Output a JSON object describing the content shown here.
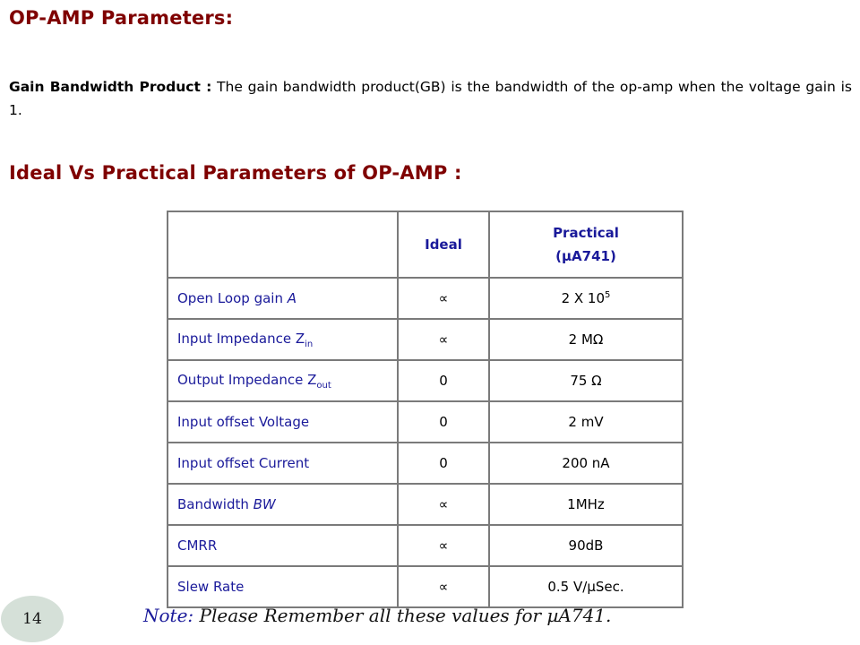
{
  "title": "OP-AMP Parameters:",
  "gbp": {
    "term": "Gain Bandwidth Product :",
    "definition": "The gain bandwidth product(GB) is the bandwidth of the op-amp when the voltage gain is 1."
  },
  "subtitle": "Ideal Vs Practical Parameters of OP-AMP :",
  "table": {
    "headers": [
      "",
      "Ideal",
      "Practical (µA741)"
    ],
    "rows": [
      {
        "name": "Open Loop gain ",
        "name_var": "A",
        "name_sub": "",
        "ideal": "∝",
        "practical": "2 X 10",
        "practical_sup": "5"
      },
      {
        "name": "Input Impedance Z",
        "name_var": "",
        "name_sub": "in",
        "ideal": "∝",
        "practical": "2 MΩ",
        "practical_sup": ""
      },
      {
        "name": "Output Impedance Z",
        "name_var": "",
        "name_sub": "out",
        "ideal": "0",
        "practical": "75 Ω",
        "practical_sup": ""
      },
      {
        "name": "Input offset Voltage",
        "name_var": "",
        "name_sub": "",
        "ideal": "0",
        "practical": "2 mV",
        "practical_sup": ""
      },
      {
        "name": "Input offset Current",
        "name_var": "",
        "name_sub": "",
        "ideal": "0",
        "practical": "200 nA",
        "practical_sup": ""
      },
      {
        "name": "Bandwidth ",
        "name_var": "BW",
        "name_sub": "",
        "ideal": "∝",
        "practical": "1MHz",
        "practical_sup": ""
      },
      {
        "name": "CMRR",
        "name_var": "",
        "name_sub": "",
        "ideal": "∝",
        "practical": "90dB",
        "practical_sup": ""
      },
      {
        "name": "Slew Rate",
        "name_var": "",
        "name_sub": "",
        "ideal": "∝",
        "practical": "0.5 V/µSec.",
        "practical_sup": ""
      }
    ]
  },
  "footer": {
    "page_number": "14",
    "note_label": "Note:",
    "note_text": " Please Remember all these values for µA741."
  },
  "colors": {
    "title": "#7f0000",
    "table_text": "#1a1a9a",
    "badge_bg": "#d5e0d8"
  }
}
